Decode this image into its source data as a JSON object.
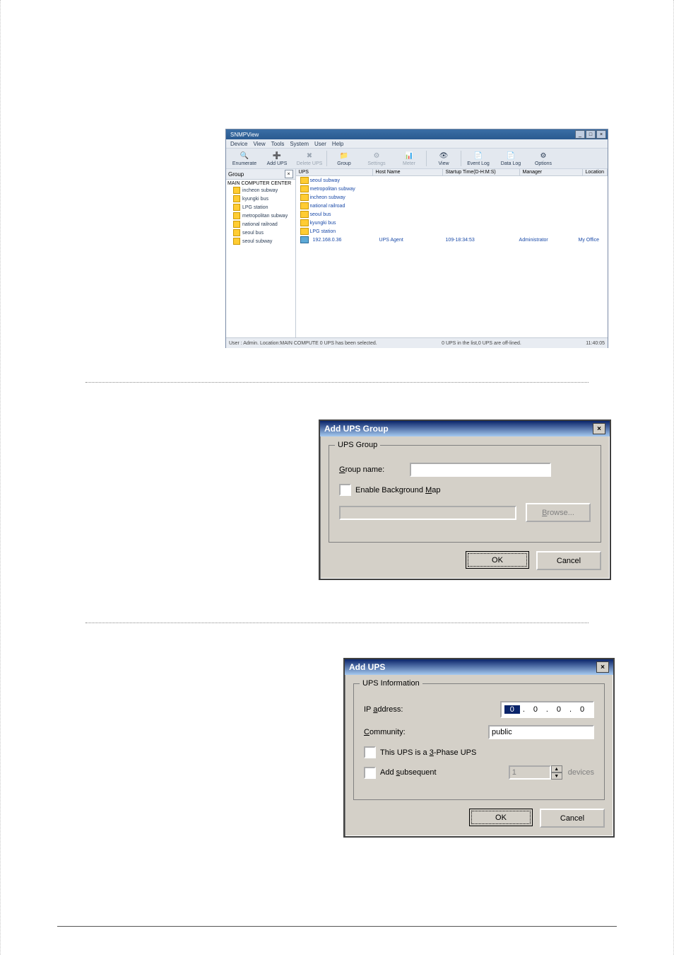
{
  "app": {
    "title": "SNMPView",
    "wincontrols": {
      "min": "_",
      "max": "□",
      "close": "×"
    },
    "menu": [
      "Device",
      "View",
      "Tools",
      "System",
      "User",
      "Help"
    ],
    "toolbar": [
      {
        "name": "enumerate",
        "label": "Enumerate",
        "icon": "🔍",
        "dis": false
      },
      {
        "name": "addups",
        "label": "Add UPS",
        "icon": "➕",
        "dis": false
      },
      {
        "name": "deleteups",
        "label": "Delete UPS",
        "icon": "✖",
        "dis": true
      },
      {
        "name": "group",
        "label": "Group",
        "icon": "📁",
        "dis": false
      },
      {
        "name": "settings",
        "label": "Settings",
        "icon": "⚙",
        "dis": true
      },
      {
        "name": "meter",
        "label": "Meter",
        "icon": "📊",
        "dis": true
      },
      {
        "name": "view",
        "label": "View",
        "icon": "👁",
        "dis": false
      },
      {
        "name": "eventlog",
        "label": "Event Log",
        "icon": "📄",
        "dis": false
      },
      {
        "name": "datalog",
        "label": "Data Log",
        "icon": "📄",
        "dis": false
      },
      {
        "name": "options",
        "label": "Options",
        "icon": "⚙",
        "dis": false
      }
    ],
    "sidebar": {
      "header": "Group",
      "root": "MAIN COMPUTER CENTER",
      "items": [
        "incheon subway",
        "kyungki bus",
        "LPG station",
        "metropolitan subway",
        "national railroad",
        "seoul bus",
        "seoul subway"
      ]
    },
    "columns": {
      "ups": "UPS",
      "host": "Host Name",
      "start": "Startup Time(D-H:M:S)",
      "manager": "Manager",
      "location": "Location"
    },
    "rows": {
      "folders": [
        "seoul subway",
        "metropolitan subway",
        "incheon subway",
        "national railroad",
        "seoul bus",
        "kyungki bus",
        "LPG station"
      ],
      "agent": {
        "ip": "192.168.0.36",
        "host": "UPS Agent",
        "start": "109-18:34:53",
        "manager": "Administrator",
        "location": "My Office"
      }
    },
    "status": {
      "left": "User : Admin.  Location:MAIN COMPUTE  0 UPS has been selected.",
      "mid": "0 UPS in the list,0 UPS are off-lined.",
      "time": "11:40:05"
    }
  },
  "dlg_group": {
    "title": "Add UPS Group",
    "legend": "UPS Group",
    "group_name": "Group name:",
    "enable_map": "Enable Background Map",
    "browse": "Browse...",
    "ok": "OK",
    "cancel": "Cancel"
  },
  "dlg_add": {
    "title": "Add UPS",
    "legend": "UPS Information",
    "ip_label": "IP address:",
    "ip": [
      "0",
      "0",
      "0",
      "0"
    ],
    "community_label": "Community:",
    "community_value": "public",
    "three_phase": "This UPS is a 3-Phase UPS",
    "add_sub": "Add subsequent",
    "count": "1",
    "devices": "devices",
    "ok": "OK",
    "cancel": "Cancel"
  }
}
